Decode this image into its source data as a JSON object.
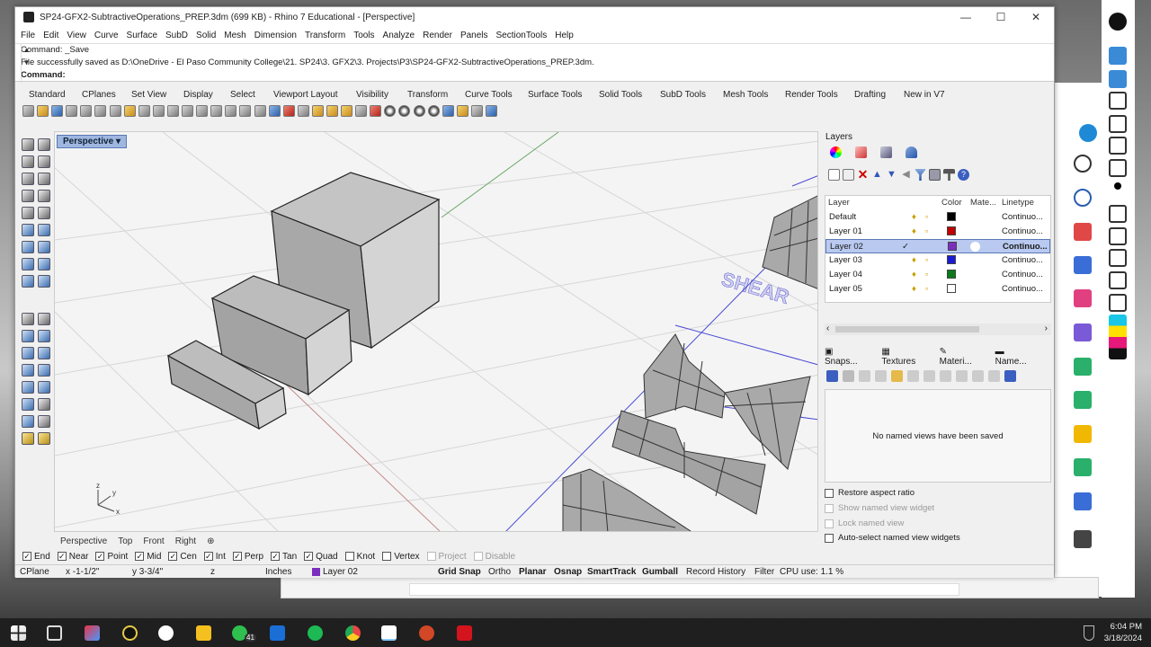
{
  "window": {
    "title": "SP24-GFX2-SubtractiveOperations_PREP.3dm (699 KB) - Rhino 7 Educational - [Perspective]",
    "minimize": "—",
    "maximize": "☐",
    "close": "✕"
  },
  "menu": [
    "File",
    "Edit",
    "View",
    "Curve",
    "Surface",
    "SubD",
    "Solid",
    "Mesh",
    "Dimension",
    "Transform",
    "Tools",
    "Analyze",
    "Render",
    "Panels",
    "SectionTools",
    "Help"
  ],
  "command": {
    "history_1": "Command: _Save",
    "history_2": "File successfully saved as D:\\OneDrive - El Paso Community College\\21. SP24\\3. GFX2\\3. Projects\\P3\\SP24-GFX2-SubtractiveOperations_PREP.3dm.",
    "prompt": "Command:"
  },
  "toolbar_tabs": [
    "Standard",
    "CPlanes",
    "Set View",
    "Display",
    "Select",
    "Viewport Layout",
    "Visibility",
    "Transform",
    "Curve Tools",
    "Surface Tools",
    "Solid Tools",
    "SubD Tools",
    "Mesh Tools",
    "Render Tools",
    "Drafting",
    "New in V7"
  ],
  "viewport": {
    "label": "Perspective",
    "label_arrow": "▾",
    "text_object": "SHEAR",
    "axis_z": "z",
    "axis_y": "y",
    "axis_x": "x"
  },
  "viewport_tabs": [
    "Perspective",
    "Top",
    "Front",
    "Right",
    "⊕"
  ],
  "osnaps": [
    {
      "label": "End",
      "checked": true,
      "enabled": true
    },
    {
      "label": "Near",
      "checked": true,
      "enabled": true
    },
    {
      "label": "Point",
      "checked": true,
      "enabled": true
    },
    {
      "label": "Mid",
      "checked": true,
      "enabled": true
    },
    {
      "label": "Cen",
      "checked": true,
      "enabled": true
    },
    {
      "label": "Int",
      "checked": true,
      "enabled": true
    },
    {
      "label": "Perp",
      "checked": true,
      "enabled": true
    },
    {
      "label": "Tan",
      "checked": true,
      "enabled": true
    },
    {
      "label": "Quad",
      "checked": true,
      "enabled": true
    },
    {
      "label": "Knot",
      "checked": false,
      "enabled": true
    },
    {
      "label": "Vertex",
      "checked": false,
      "enabled": true
    },
    {
      "label": "Project",
      "checked": false,
      "enabled": false
    },
    {
      "label": "Disable",
      "checked": false,
      "enabled": false
    }
  ],
  "status": {
    "cplane": "CPlane",
    "x": "x -1-1/2\"",
    "y": "y 3-3/4\"",
    "z": "z",
    "units": "Inches",
    "layer": "Layer 02",
    "layer_color": "#7b2fbf",
    "grid_snap": "Grid Snap",
    "ortho": "Ortho",
    "planar": "Planar",
    "osnap": "Osnap",
    "smarttrack": "SmartTrack",
    "gumball": "Gumball",
    "record_history": "Record History",
    "filter": "Filter",
    "cpu": "CPU use: 1.1 %"
  },
  "layers_panel": {
    "title": "Layers",
    "headers": {
      "layer": "Layer",
      "color": "Color",
      "material": "Mate...",
      "linetype": "Linetype"
    },
    "rows": [
      {
        "name": "Default",
        "color": "#000000",
        "linetype": "Continuo...",
        "current": false
      },
      {
        "name": "Layer 01",
        "color": "#c00000",
        "linetype": "Continuo...",
        "current": false
      },
      {
        "name": "Layer 02",
        "color": "#7b2fbf",
        "linetype": "Continuo...",
        "current": true
      },
      {
        "name": "Layer 03",
        "color": "#1a1ad6",
        "linetype": "Continuo...",
        "current": false
      },
      {
        "name": "Layer 04",
        "color": "#0a7a1a",
        "linetype": "Continuo...",
        "current": false
      },
      {
        "name": "Layer 05",
        "color": "#ffffff",
        "linetype": "Continuo...",
        "current": false
      }
    ],
    "check_mark": "✓",
    "scroll_left": "‹",
    "scroll_right": "›"
  },
  "sub_panel": {
    "tabs": [
      "Snaps...",
      "Textures",
      "Materi...",
      "Name..."
    ],
    "empty_message": "No named views have been saved",
    "options": [
      {
        "label": "Restore aspect ratio",
        "enabled": true
      },
      {
        "label": "Show named view widget",
        "enabled": false
      },
      {
        "label": "Lock named view",
        "enabled": false
      },
      {
        "label": "Auto-select named view widgets",
        "enabled": true
      }
    ]
  },
  "taskbar": {
    "time": "6:04 PM",
    "date": "3/18/2024",
    "whatsapp_badge": "41"
  }
}
